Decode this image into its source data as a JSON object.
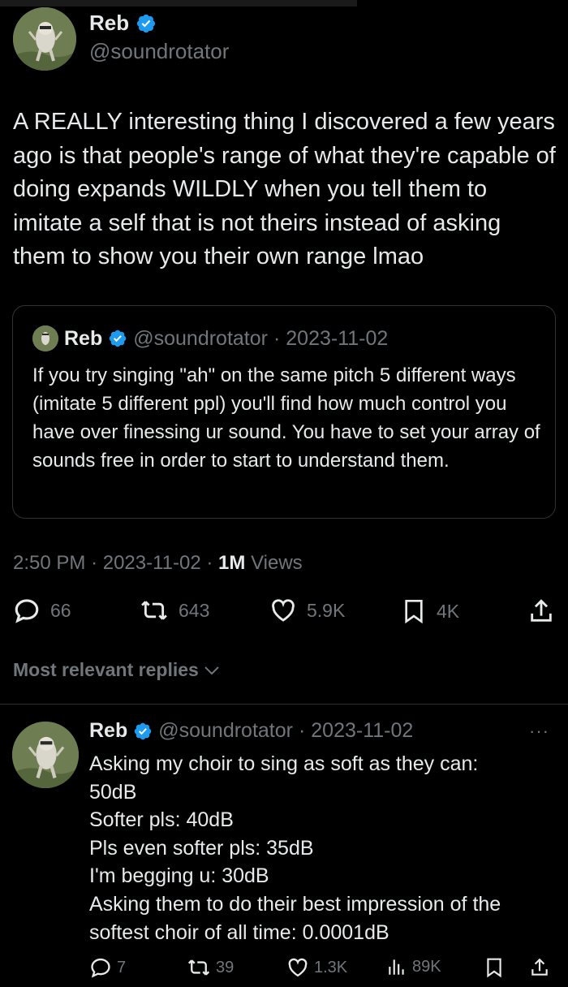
{
  "tweet": {
    "author": {
      "name": "Reb",
      "handle": "@soundrotator",
      "verified": true
    },
    "text": "A REALLY interesting thing I discovered a few years ago is that people's range of what they're capable of doing expands WILDLY when you tell them to imitate a self that is not theirs instead of asking them to show you their own range lmao",
    "quote": {
      "name": "Reb",
      "handle": "@soundrotator",
      "dot_date": "· 2023-11-02",
      "text": "If you try singing \"ah\" on the same pitch 5 different ways (imitate 5 different ppl) you'll find how much control you have over finessing ur sound. You have to set your array of sounds free in order to start to understand them."
    },
    "time": "2:50 PM",
    "date": "· 2023-11-02 ·",
    "views_count": "1M",
    "views_label": "Views",
    "stats": {
      "replies": "66",
      "retweets": "643",
      "likes": "5.9K",
      "bookmarks": "4K"
    }
  },
  "replies_filter": {
    "label": "Most relevant replies"
  },
  "reply": {
    "name": "Reb",
    "handle": "@soundrotator",
    "dot_date": "· 2023-11-02",
    "more": "···",
    "lines": [
      "Asking my choir to sing as soft as they can:",
      "50dB",
      "Softer pls: 40dB",
      "Pls even softer pls: 35dB",
      "I'm begging u: 30dB",
      "Asking them to do their best impression of the",
      "softest choir of all time: 0.0001dB"
    ],
    "stats": {
      "replies": "7",
      "retweets": "39",
      "likes": "1.3K",
      "views": "89K"
    }
  },
  "colors": {
    "background": "#000000",
    "text": "#e7e9ea",
    "muted": "#71767b",
    "border": "#2f3336",
    "verified": "#1d9bf0"
  }
}
